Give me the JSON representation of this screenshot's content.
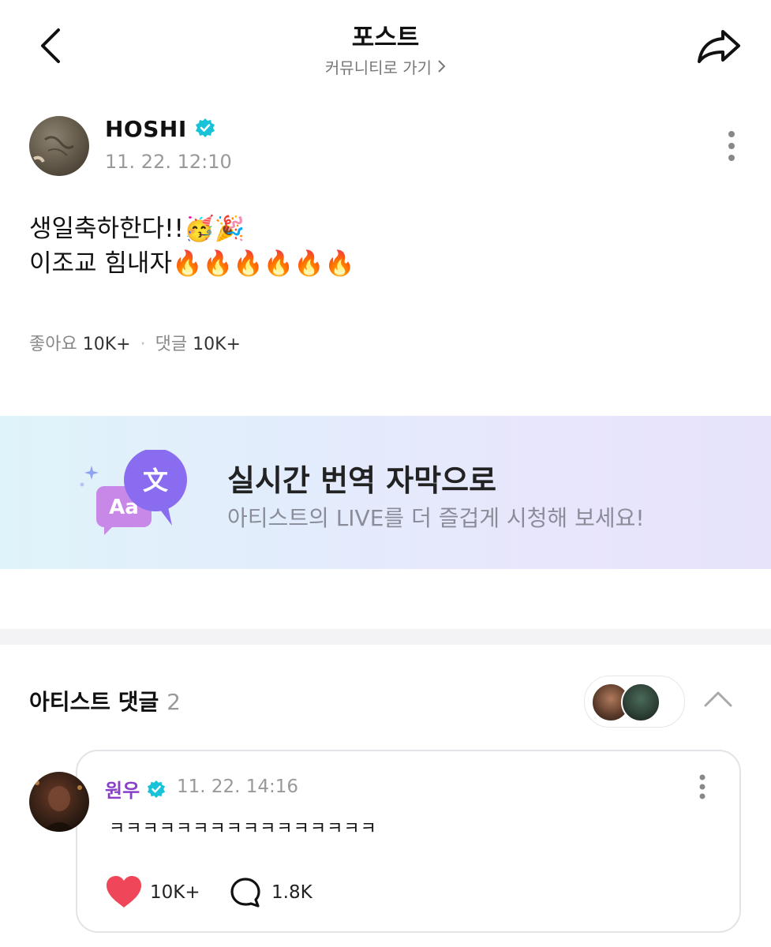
{
  "header": {
    "title": "포스트",
    "community_link": "커뮤니티로 가기"
  },
  "post": {
    "author": "HOSHI",
    "date": "11. 22. 12:10",
    "line1": "생일축하한다!!🥳🎉",
    "line2": "이조교 힘내자🔥🔥🔥🔥🔥🔥",
    "likes_label": "좋아요",
    "likes": "10K+",
    "comments_label": "댓글",
    "comments": "10K+"
  },
  "banner": {
    "title": "실시간 번역 자막으로",
    "subtitle": "아티스트의 LIVE를 더 즐겁게 시청해 보세요!",
    "icon_back_text": "Aa",
    "icon_front_text": "文"
  },
  "artist_comments": {
    "title": "아티스트 댓글",
    "count": "2",
    "comment": {
      "author": "원우",
      "date": "11. 22. 14:16",
      "text": "ㅋㅋㅋㅋㅋㅋㅋㅋㅋㅋㅋㅋㅋㅋㅋㅋ",
      "likes": "10K+",
      "replies": "1.8K"
    }
  },
  "colors": {
    "verified": "#18c2d8",
    "artist_name": "#8a3fc9",
    "like_heart": "#f0465a",
    "banner_bubble": "#8a6cf0"
  },
  "icons": [
    "back-chevron-icon",
    "share-arrow-icon",
    "verified-badge-icon",
    "more-vertical-icon",
    "translate-bubble-icon",
    "chevron-up-icon",
    "heart-icon",
    "comment-bubble-icon"
  ]
}
